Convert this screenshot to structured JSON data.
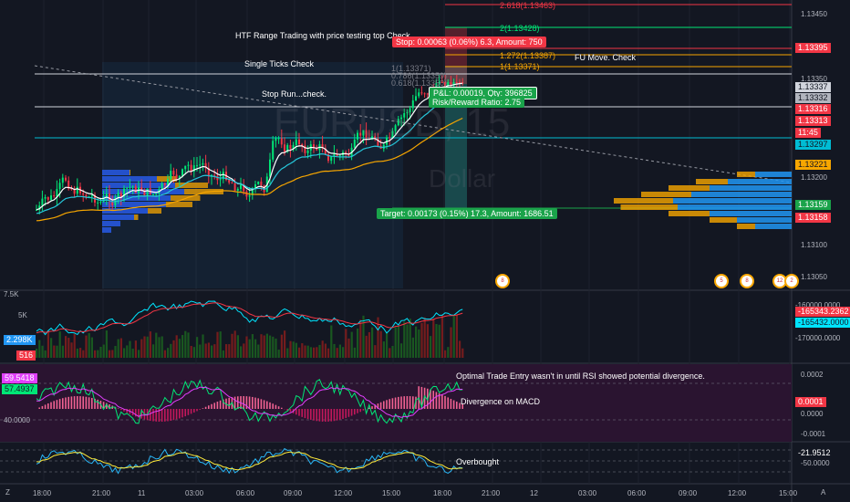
{
  "watermark": {
    "symbol": "EURUSD, 15",
    "subtitle": "Dollar"
  },
  "price_axis": {
    "ticks": [
      "1.13450",
      "1.13350",
      "1.13200",
      "1.13100",
      "1.13050"
    ],
    "labels": [
      {
        "text": "1.13395",
        "bg": "#f23645",
        "fg": "#ffffff"
      },
      {
        "text": "1.13337",
        "bg": "#d1d4dc",
        "fg": "#131722"
      },
      {
        "text": "1.13332",
        "bg": "#b2b5be",
        "fg": "#131722"
      },
      {
        "text": "1.13316",
        "bg": "#f23645",
        "fg": "#ffffff"
      },
      {
        "text": "1.13313",
        "bg": "#f23645",
        "fg": "#ffffff"
      },
      {
        "text": "11:45",
        "bg": "#f23645",
        "fg": "#ffffff"
      },
      {
        "text": "1.13297",
        "bg": "#00bcd4",
        "fg": "#131722"
      },
      {
        "text": "1.13221",
        "bg": "#f7a600",
        "fg": "#131722"
      },
      {
        "text": "1.13159",
        "bg": "#1aa34a",
        "fg": "#ffffff"
      },
      {
        "text": "1.13158",
        "bg": "#f23645",
        "fg": "#ffffff"
      }
    ]
  },
  "annotations": {
    "htf": "HTF Range Trading with price testing top Check",
    "single_ticks": "Single Ticks Check",
    "stop_run": "Stop Run...check.",
    "fu_move": "FU Move. Check",
    "ote": "Optimal Trade Entry wasn't in until RSI showed potential divergence.",
    "divergence": "Divergence on MACD",
    "overbought": "Overbought"
  },
  "position": {
    "stop": "Stop: 0.00063 (0.06%) 6.3, Amount: 750",
    "pnl": "P&L: 0.00019, Qty: 396825",
    "rr": "Risk/Reward Ratio: 2.75",
    "target": "Target: 0.00173 (0.15%) 17.3, Amount: 1686.51"
  },
  "fib_levels": [
    "2.618(1.13463)",
    "2(1.13428)",
    "1.272(1.13387)",
    "1(1.13371)",
    "0.786(1.13359)",
    "0.618(1.13350)"
  ],
  "events": [
    "8",
    "5",
    "8",
    "12",
    "2"
  ],
  "volume_pane": {
    "left_ticks": [
      "7.5K",
      "5K"
    ],
    "left_labels": [
      {
        "text": "2.298K",
        "bg": "#2196f3"
      },
      {
        "text": "516",
        "bg": "#f23645"
      }
    ],
    "right_ticks": [
      "-160000.0000",
      "-170000.0000"
    ],
    "right_labels": [
      {
        "text": "-165343.2362",
        "bg": "#f23645",
        "fg": "#ffffff"
      },
      {
        "text": "-165432.0000",
        "bg": "#00e5ff",
        "fg": "#131722"
      }
    ]
  },
  "macd_pane": {
    "left_labels": [
      {
        "text": "59.5418",
        "bg": "#e040fb"
      },
      {
        "text": "57.4937",
        "bg": "#00e676"
      }
    ],
    "left_ticks": [
      "40.0000"
    ],
    "right_ticks": [
      "0.0002",
      "0.0000",
      "-0.0001"
    ],
    "right_label": {
      "text": "0.0001",
      "bg": "#f23645"
    }
  },
  "osc_pane": {
    "right_ticks": [
      "-50.0000"
    ],
    "right_labels": [
      {
        "text": "-21.9512",
        "bg": "#131722",
        "fg": "#ffffff"
      }
    ]
  },
  "time_axis": [
    "18:00",
    "21:00",
    "11",
    "03:00",
    "06:00",
    "09:00",
    "12:00",
    "15:00",
    "18:00",
    "21:00",
    "12",
    "03:00",
    "06:00",
    "09:00",
    "12:00",
    "15:00"
  ],
  "corner": {
    "left": "Z",
    "right": "A"
  },
  "colors": {
    "up": "#26a69a",
    "bull": "#00e676",
    "bear": "#f23645",
    "bg": "#131722",
    "grid": "#2a2e39"
  }
}
